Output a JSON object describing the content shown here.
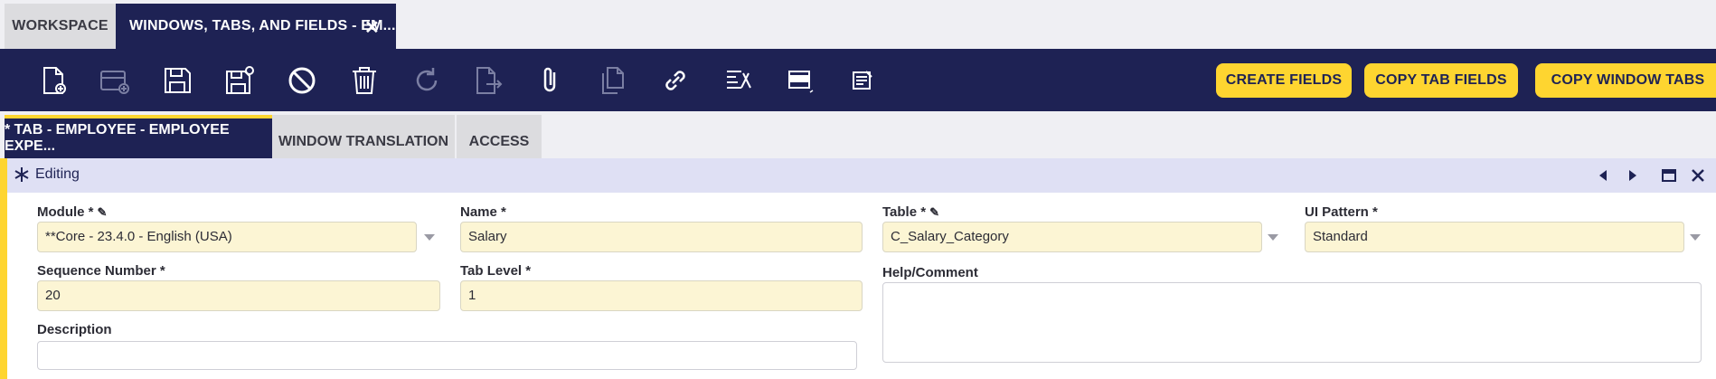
{
  "top_tabs": {
    "workspace": "WORKSPACE",
    "active": "WINDOWS, TABS, AND FIELDS - EM...",
    "close": "✕"
  },
  "toolbar": {
    "icons": [
      "new-document-icon",
      "new-record-icon",
      "save-icon",
      "save-close-icon",
      "undo-icon",
      "delete-icon",
      "refresh-icon",
      "export-icon",
      "attachment-icon",
      "copy-record-icon",
      "link-icon",
      "tree-icon",
      "grid-toggle-icon",
      "audit-trail-icon"
    ],
    "create_fields": "CREATE FIELDS",
    "copy_tab_fields": "COPY TAB FIELDS",
    "copy_window_tabs": "COPY WINDOW TABS"
  },
  "sub_tabs": {
    "active": "* TAB - EMPLOYEE - EMPLOYEE EXPE...",
    "window_translation": "WINDOW TRANSLATION",
    "access": "ACCESS"
  },
  "status": {
    "text": "Editing"
  },
  "form": {
    "module": {
      "label": "Module *",
      "value": "**Core - 23.4.0 - English (USA)"
    },
    "name": {
      "label": "Name *",
      "value": "Salary"
    },
    "table": {
      "label": "Table *",
      "value": "C_Salary_Category"
    },
    "ui_pattern": {
      "label": "UI Pattern *",
      "value": "Standard"
    },
    "sequence_number": {
      "label": "Sequence Number *",
      "value": "20"
    },
    "tab_level": {
      "label": "Tab Level *",
      "value": "1"
    },
    "help_comment": {
      "label": "Help/Comment",
      "value": ""
    },
    "description": {
      "label": "Description",
      "value": ""
    }
  },
  "colors": {
    "navy": "#1e2254",
    "accent_yellow": "#fed530",
    "field_fill": "#fcf5d4",
    "status_bar": "#dfe0f4"
  }
}
